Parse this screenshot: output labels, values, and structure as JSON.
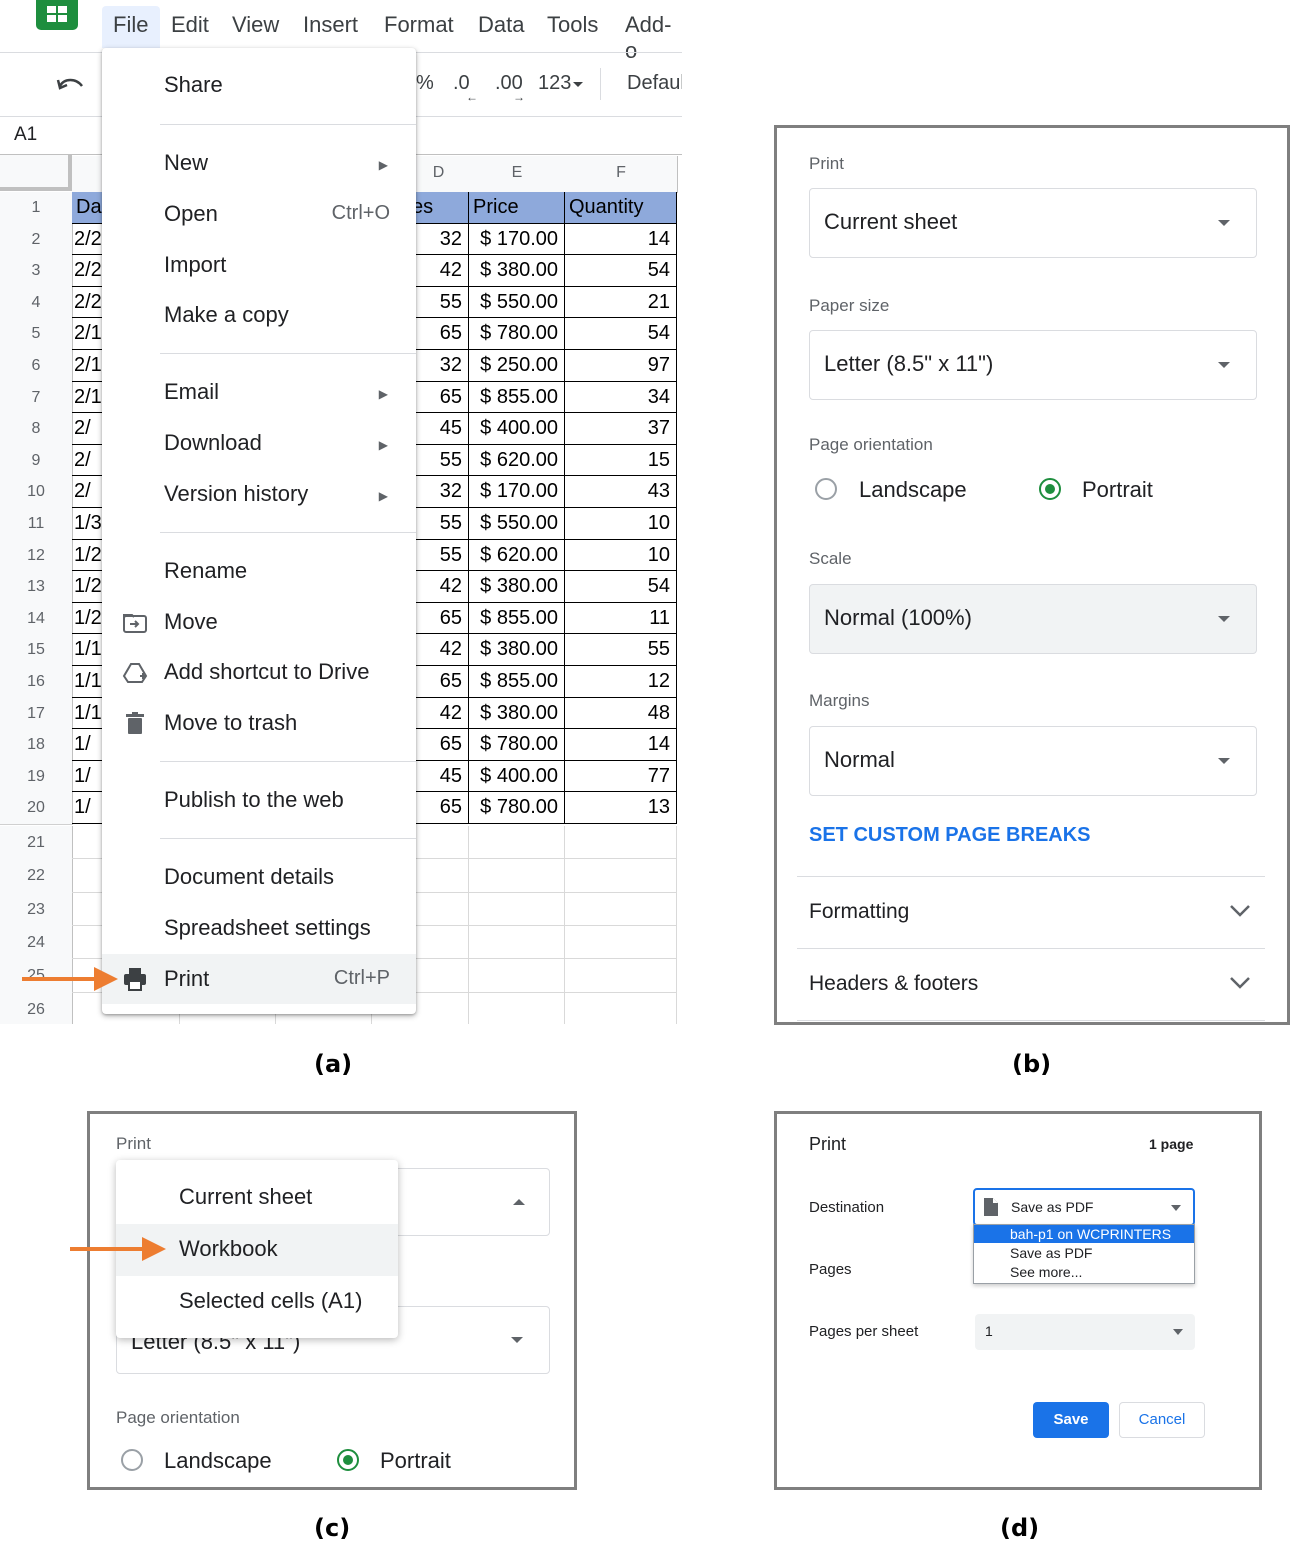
{
  "panel_a": {
    "caption": "(a)",
    "menubar": [
      "File",
      "Edit",
      "View",
      "Insert",
      "Format",
      "Data",
      "Tools",
      "Add-o"
    ],
    "toolbar": {
      "percent": "%",
      "dec_decrease": ".0",
      "dec_increase": ".00",
      "format_more": "123",
      "font": "Defaul"
    },
    "name_box": "A1",
    "column_headers": [
      "D",
      "E",
      "F"
    ],
    "table_headers": [
      "Da",
      "es",
      "Price",
      "Quantity"
    ],
    "row_numbers": [
      "1",
      "2",
      "3",
      "4",
      "5",
      "6",
      "7",
      "8",
      "9",
      "10",
      "11",
      "12",
      "13",
      "14",
      "15",
      "16",
      "17",
      "18",
      "19",
      "20",
      "21",
      "22",
      "23",
      "24",
      "25",
      "26"
    ],
    "rows": [
      {
        "a": "2/2",
        "d": "32",
        "price": "$ 170.00",
        "qty": "14"
      },
      {
        "a": "2/2",
        "d": "42",
        "price": "$ 380.00",
        "qty": "54"
      },
      {
        "a": "2/2",
        "d": "55",
        "price": "$ 550.00",
        "qty": "21"
      },
      {
        "a": "2/1",
        "d": "65",
        "price": "$ 780.00",
        "qty": "54"
      },
      {
        "a": "2/1",
        "d": "32",
        "price": "$ 250.00",
        "qty": "97"
      },
      {
        "a": "2/1",
        "d": "65",
        "price": "$ 855.00",
        "qty": "34"
      },
      {
        "a": "2/",
        "d": "45",
        "price": "$ 400.00",
        "qty": "37"
      },
      {
        "a": "2/",
        "d": "55",
        "price": "$ 620.00",
        "qty": "15"
      },
      {
        "a": "2/",
        "d": "32",
        "price": "$ 170.00",
        "qty": "43"
      },
      {
        "a": "1/3",
        "d": "55",
        "price": "$ 550.00",
        "qty": "10"
      },
      {
        "a": "1/2",
        "d": "55",
        "price": "$ 620.00",
        "qty": "10"
      },
      {
        "a": "1/2",
        "d": "42",
        "price": "$ 380.00",
        "qty": "54"
      },
      {
        "a": "1/2",
        "d": "65",
        "price": "$ 855.00",
        "qty": "11"
      },
      {
        "a": "1/1",
        "d": "42",
        "price": "$ 380.00",
        "qty": "55"
      },
      {
        "a": "1/1",
        "d": "65",
        "price": "$ 855.00",
        "qty": "12"
      },
      {
        "a": "1/1",
        "d": "42",
        "price": "$ 380.00",
        "qty": "48"
      },
      {
        "a": "1/",
        "d": "65",
        "price": "$ 780.00",
        "qty": "14"
      },
      {
        "a": "1/",
        "d": "45",
        "price": "$ 400.00",
        "qty": "77"
      },
      {
        "a": "1/",
        "d": "65",
        "price": "$ 780.00",
        "qty": "13"
      }
    ],
    "file_menu": {
      "share": "Share",
      "new": "New",
      "open": "Open",
      "open_shortcut": "Ctrl+O",
      "import": "Import",
      "make_copy": "Make a copy",
      "email": "Email",
      "download": "Download",
      "version_history": "Version history",
      "rename": "Rename",
      "move": "Move",
      "add_shortcut": "Add shortcut to Drive",
      "move_trash": "Move to trash",
      "publish": "Publish to the web",
      "doc_details": "Document details",
      "sheet_settings": "Spreadsheet settings",
      "print": "Print",
      "print_shortcut": "Ctrl+P"
    }
  },
  "panel_b": {
    "caption": "(b)",
    "print_label": "Print",
    "print_value": "Current sheet",
    "paper_label": "Paper size",
    "paper_value": "Letter (8.5\" x 11\")",
    "orientation_label": "Page orientation",
    "landscape": "Landscape",
    "portrait": "Portrait",
    "scale_label": "Scale",
    "scale_value": "Normal (100%)",
    "margins_label": "Margins",
    "margins_value": "Normal",
    "custom_breaks": "SET CUSTOM PAGE BREAKS",
    "formatting": "Formatting",
    "headers_footers": "Headers & footers",
    "accent_color": "#1a73e8",
    "radio_color": "#1e8e3e"
  },
  "panel_c": {
    "caption": "(c)",
    "print_label": "Print",
    "options": [
      "Current sheet",
      "Workbook",
      "Selected cells (A1)"
    ],
    "paper_value_partial": "Letter (8.5\" x 11\")",
    "orientation_label": "Page orientation",
    "landscape": "Landscape",
    "portrait": "Portrait"
  },
  "panel_d": {
    "caption": "(d)",
    "title": "Print",
    "page_count": "1 page",
    "destination_label": "Destination",
    "destination_value": "Save as PDF",
    "destination_options": [
      "bah-p1 on WCPRINTERS",
      "Save as PDF",
      "See more..."
    ],
    "pages_label": "Pages",
    "pages_per_sheet_label": "Pages per sheet",
    "pages_per_sheet_value": "1",
    "save": "Save",
    "cancel": "Cancel"
  },
  "arrow_color": "#ed7d31"
}
